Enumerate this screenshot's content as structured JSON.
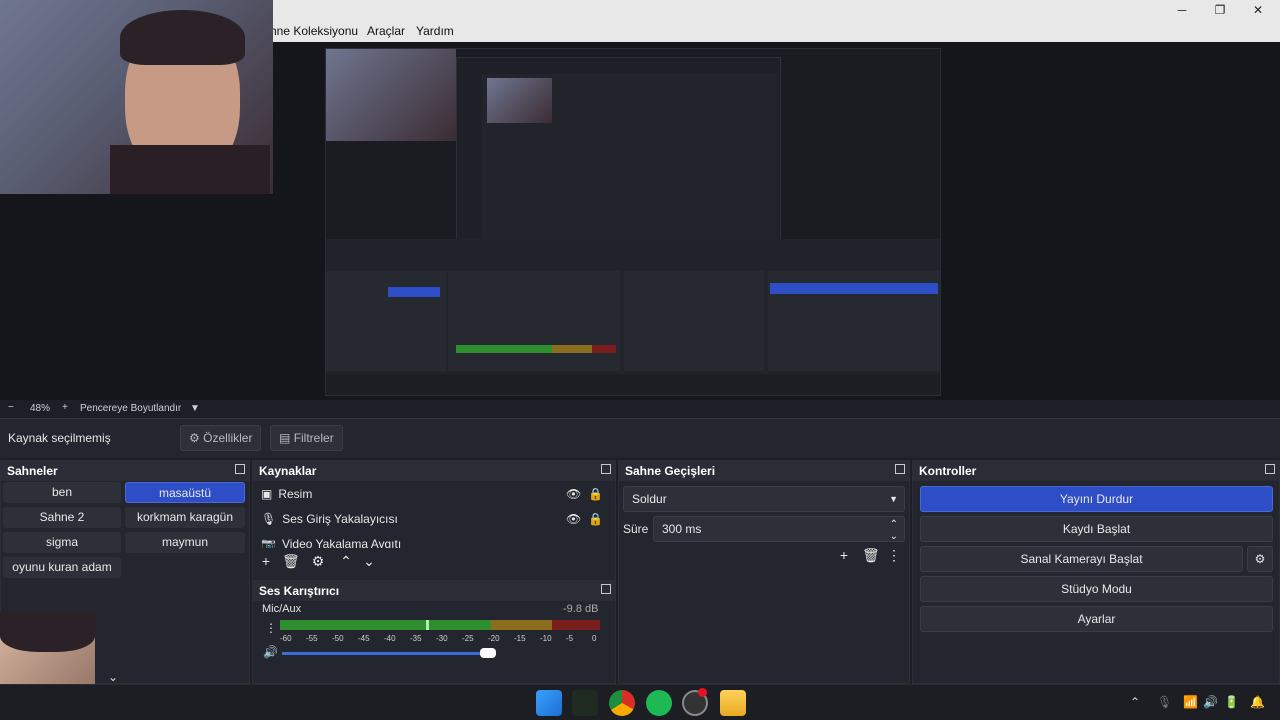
{
  "window": {
    "minimize": "─",
    "maximize": "❐",
    "close": "✕"
  },
  "menu": {
    "items": [
      "hne Koleksiyonu",
      "Araçlar",
      "Yardım"
    ]
  },
  "zoom": {
    "minus": "−",
    "value": "48%",
    "plus": "+",
    "label": "Pencereye Boyutlandır",
    "caret": "▼"
  },
  "sourcebar": {
    "status": "Kaynak seçilmemiş",
    "properties": "Özellikler",
    "filters": "Filtreler"
  },
  "scenes": {
    "title": "Sahneler",
    "items": [
      "ben",
      "masaüstü",
      "Sahne 2",
      "korkmam karagün",
      "sigma",
      "maymun",
      "oyunu kuran adam"
    ],
    "active": "masaüstü"
  },
  "sources": {
    "title": "Kaynaklar",
    "items": [
      {
        "label": "Resim",
        "icon": "image-icon"
      },
      {
        "label": "Ses Giriş Yakalayıcısı",
        "icon": "microphone-icon"
      },
      {
        "label": "Video Yakalama Aygıtı",
        "icon": "camera-icon"
      }
    ],
    "toolbar": [
      "+",
      "🗑",
      "⚙",
      "⌃",
      "⌄"
    ]
  },
  "mixer": {
    "title": "Ses Karıştırıcı",
    "channel": "Mic/Aux",
    "level": "-9.8 dB",
    "ticks": [
      "-60",
      "-55",
      "-50",
      "-45",
      "-40",
      "-35",
      "-30",
      "-25",
      "-20",
      "-15",
      "-10",
      "-5",
      "0"
    ],
    "volume_fraction": 0.97
  },
  "transitions": {
    "title": "Sahne Geçişleri",
    "selected": "Soldur",
    "duration_label": "Süre",
    "duration_value": "300 ms"
  },
  "controls": {
    "title": "Kontroller",
    "stop_stream": "Yayını Durdur",
    "start_record": "Kaydı Başlat",
    "virtual_cam": "Sanal Kamerayı Başlat",
    "studio_mode": "Stüdyo Modu",
    "settings": "Ayarlar"
  },
  "colors": {
    "accent": "#2d4ec7",
    "panel": "#23262e",
    "title": "#2a2d35"
  }
}
